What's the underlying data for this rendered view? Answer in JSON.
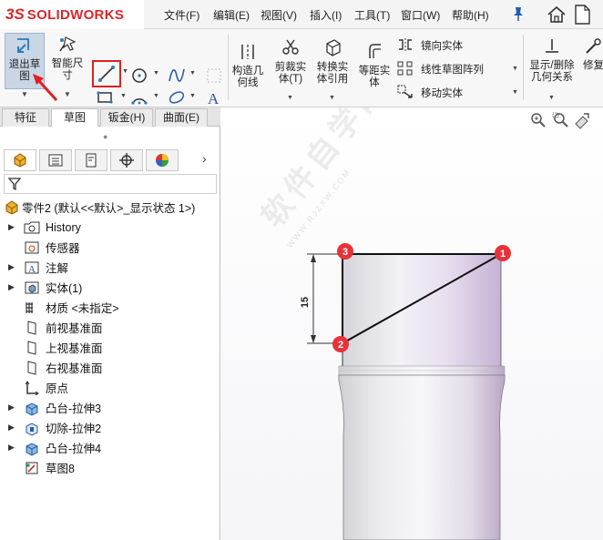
{
  "app": {
    "logo_ds": "3S",
    "logo_text": "SOLIDWORKS"
  },
  "menu": [
    "文件(F)",
    "编辑(E)",
    "视图(V)",
    "插入(I)",
    "工具(T)",
    "窗口(W)",
    "帮助(H)"
  ],
  "ribbon": {
    "exit_sketch": [
      "退出草",
      "图"
    ],
    "smart_dim": [
      "智能尺",
      "寸"
    ],
    "construct_geom": [
      "构造几",
      "何线"
    ],
    "trim": [
      "剪裁实",
      "体(T)"
    ],
    "convert": [
      "转换实",
      "体引用"
    ],
    "offset": [
      "等距实",
      "体"
    ],
    "mirror": "镜向实体",
    "linear_pattern": "线性草图阵列",
    "move": "移动实体",
    "display_relations": [
      "显示/删除",
      "几何关系"
    ],
    "repair": [
      "修复",
      ""
    ]
  },
  "tabs": [
    "特征",
    "草图",
    "钣金(H)",
    "曲面(E)"
  ],
  "tree": {
    "root": "零件2  (默认<<默认>_显示状态 1>)",
    "items": [
      {
        "label": "History",
        "expandable": true
      },
      {
        "label": "传感器",
        "expandable": false
      },
      {
        "label": "注解",
        "expandable": true
      },
      {
        "label": "实体(1)",
        "expandable": true
      },
      {
        "label": "材质 <未指定>",
        "expandable": false
      },
      {
        "label": "前视基准面",
        "expandable": false
      },
      {
        "label": "上视基准面",
        "expandable": false
      },
      {
        "label": "右视基准面",
        "expandable": false
      },
      {
        "label": "原点",
        "expandable": false
      },
      {
        "label": "凸台-拉伸3",
        "expandable": true
      },
      {
        "label": "切除-拉伸2",
        "expandable": true
      },
      {
        "label": "凸台-拉伸4",
        "expandable": true
      },
      {
        "label": "草图8",
        "expandable": false
      }
    ]
  },
  "canvas": {
    "dimension": "15",
    "markers": [
      "1",
      "2",
      "3"
    ],
    "watermark": "软件自学网",
    "watermark_url": "WWW.RJZXW.COM"
  },
  "colors": {
    "accent_red": "#e02020",
    "logo_red": "#d9262a",
    "marker_red": "#e63238"
  }
}
